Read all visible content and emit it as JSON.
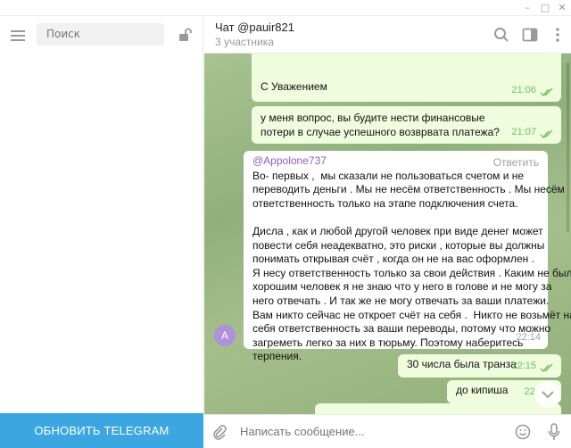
{
  "sidebar": {
    "search_placeholder": "Поиск",
    "update_label": "ОБНОВИТЬ TELEGRAM"
  },
  "chat": {
    "title": "Чат @pauir821",
    "subtitle": "3 участника"
  },
  "messages": [
    {
      "text": "С Уважением",
      "time": "21:06",
      "direction": "out"
    },
    {
      "text": "у меня вопрос, вы будите нести финансовые потери в случае успешного возврвата платежа?",
      "time": "21:07",
      "direction": "out"
    },
    {
      "author": "@Appolone737",
      "reply_label": "Ответить",
      "lines": [
        "Во- первых ,  мы сказали не пользоваться счетом и не",
        "переводить деньги . Мы не несём ответственность . Мы несём",
        "ответственность только на этапе подключения счета.",
        "",
        "Дисла , как и любой другой человек при виде денег может",
        "повести себя неадекватно, это риски , которые вы должны",
        "понимать открывая счёт , когда он не на вас оформлен .",
        "Я несу ответственность только за свои действия . Каким не был",
        "хорошим человек я не знаю что у него в голове и не могу за",
        "него отвечать . И так же не могу отвечать за ваши платежи.",
        "Вам никто сейчас не откроет счёт на себя .  Никто не возьмёт на",
        "себя ответственность за ваши переводы, потому что можно",
        "загреметь легко за них в тюрьму. Поэтому наберитесь",
        "терпения."
      ],
      "time": "22:14",
      "avatar_letter": "A",
      "direction": "in"
    },
    {
      "text": "30 числа была транза",
      "time": "22:15",
      "direction": "out"
    },
    {
      "text": "до кипиша",
      "time": "22:15",
      "direction": "out"
    }
  ],
  "composer": {
    "placeholder": "Написать сообщение..."
  },
  "colors": {
    "accent": "#3ca6e0",
    "outgoing_bubble": "#effdde",
    "incoming_bubble": "#ffffff",
    "read_ticks": "#6cbf5f",
    "author": "#8b5fbf"
  }
}
